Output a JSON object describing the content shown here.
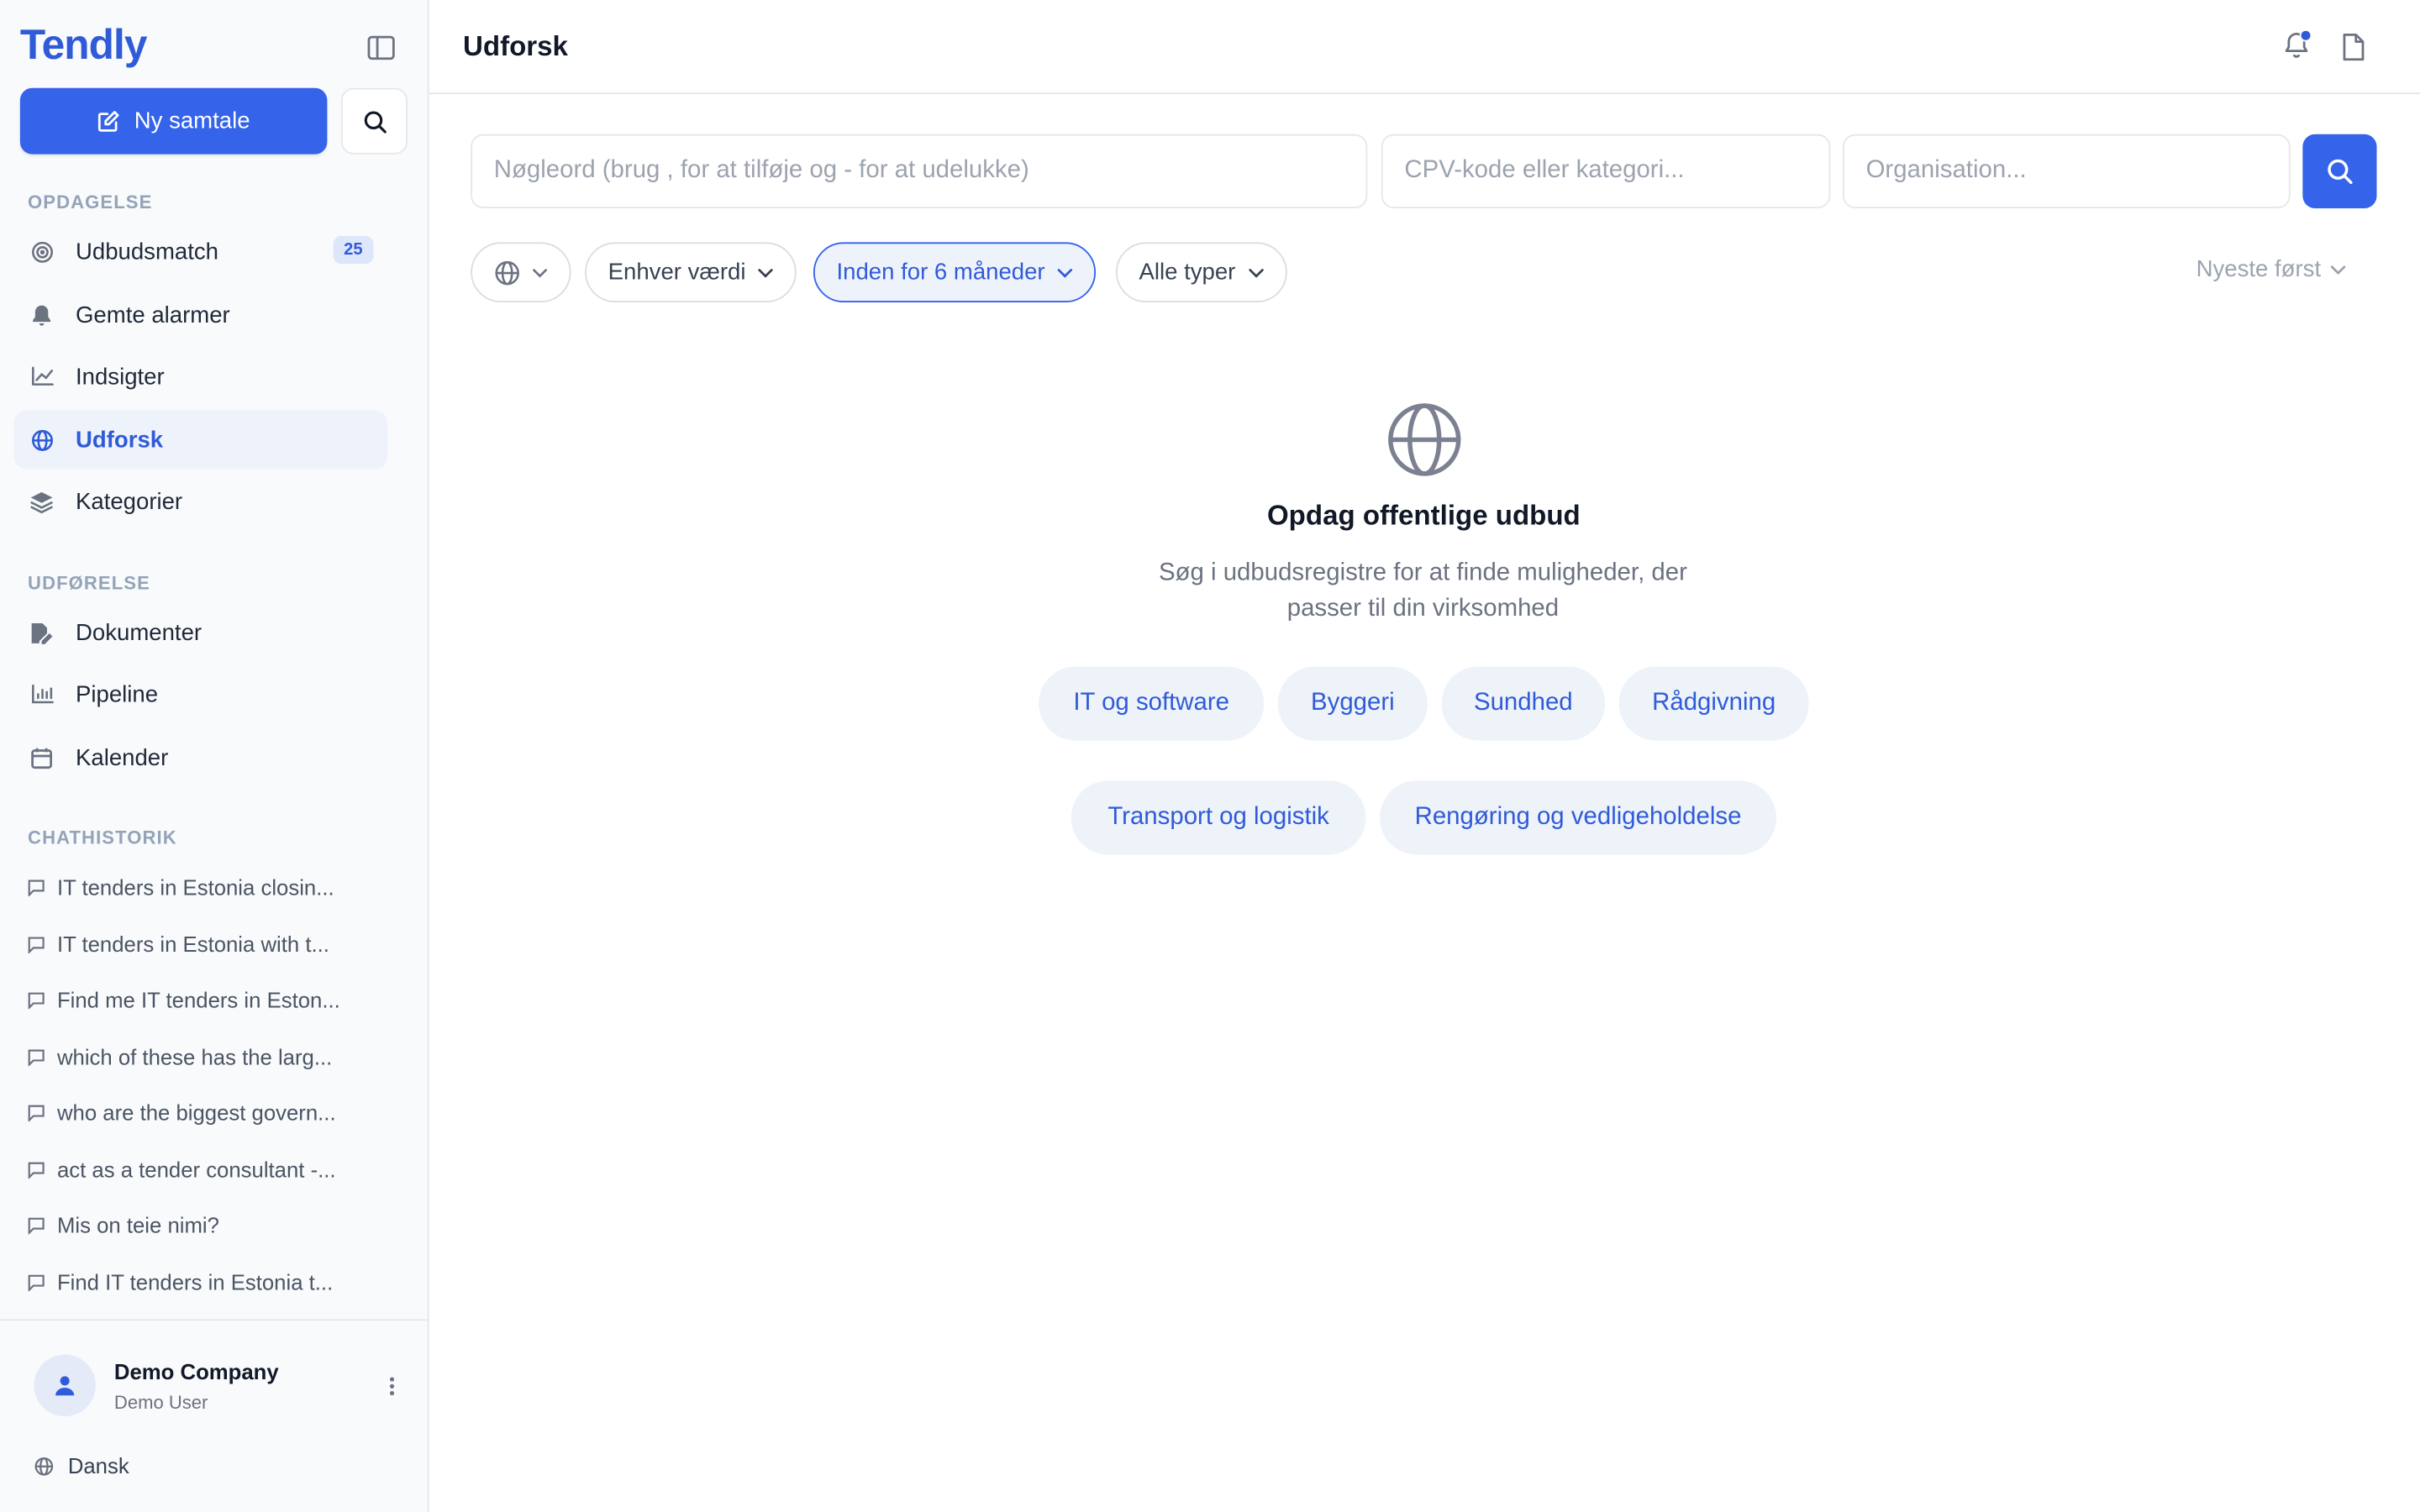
{
  "app": {
    "logo": "Tendly"
  },
  "sidebar": {
    "new_chat_label": "Ny samtale",
    "sections": {
      "discovery": "OPDAGELSE",
      "execution": "UDFØRELSE",
      "history": "CHATHISTORIK"
    },
    "discovery_items": [
      {
        "label": "Udbudsmatch",
        "icon": "target-icon",
        "badge": "25"
      },
      {
        "label": "Gemte alarmer",
        "icon": "bell-icon"
      },
      {
        "label": "Indsigter",
        "icon": "line-chart-icon"
      },
      {
        "label": "Udforsk",
        "icon": "globe-icon",
        "active": true
      },
      {
        "label": "Kategorier",
        "icon": "layers-icon"
      }
    ],
    "execution_items": [
      {
        "label": "Dokumenter",
        "icon": "file-edit-icon"
      },
      {
        "label": "Pipeline",
        "icon": "bar-chart-icon"
      },
      {
        "label": "Kalender",
        "icon": "calendar-icon"
      }
    ],
    "history": [
      "IT tenders in Estonia closin...",
      "IT tenders in Estonia with t...",
      "Find me IT tenders in Eston...",
      "which of these has the larg...",
      "who are the biggest govern...",
      "act as a tender consultant -...",
      "Mis on teie nimi?",
      "Find IT tenders in Estonia t..."
    ],
    "footer": {
      "company": "Demo Company",
      "user": "Demo User",
      "language": "Dansk"
    }
  },
  "header": {
    "title": "Udforsk"
  },
  "search": {
    "keywords_placeholder": "Nøgleord (brug , for at tilføje og - for at udelukke)",
    "cpv_placeholder": "CPV-kode eller kategori...",
    "org_placeholder": "Organisation..."
  },
  "filters": {
    "value": "Enhver værdi",
    "period": "Inden for 6 måneder",
    "types": "Alle typer",
    "sort": "Nyeste først"
  },
  "empty_state": {
    "title": "Opdag offentlige udbud",
    "description": "Søg i udbudsregistre for at finde muligheder, der passer til din virksomhed",
    "chips": [
      "IT og software",
      "Byggeri",
      "Sundhed",
      "Rådgivning",
      "Transport og logistik",
      "Rengøring og vedligeholdelse"
    ]
  },
  "colors": {
    "accent": "#3563e9",
    "accent_text": "#2f5bd8",
    "active_bg": "#eef2fb"
  }
}
